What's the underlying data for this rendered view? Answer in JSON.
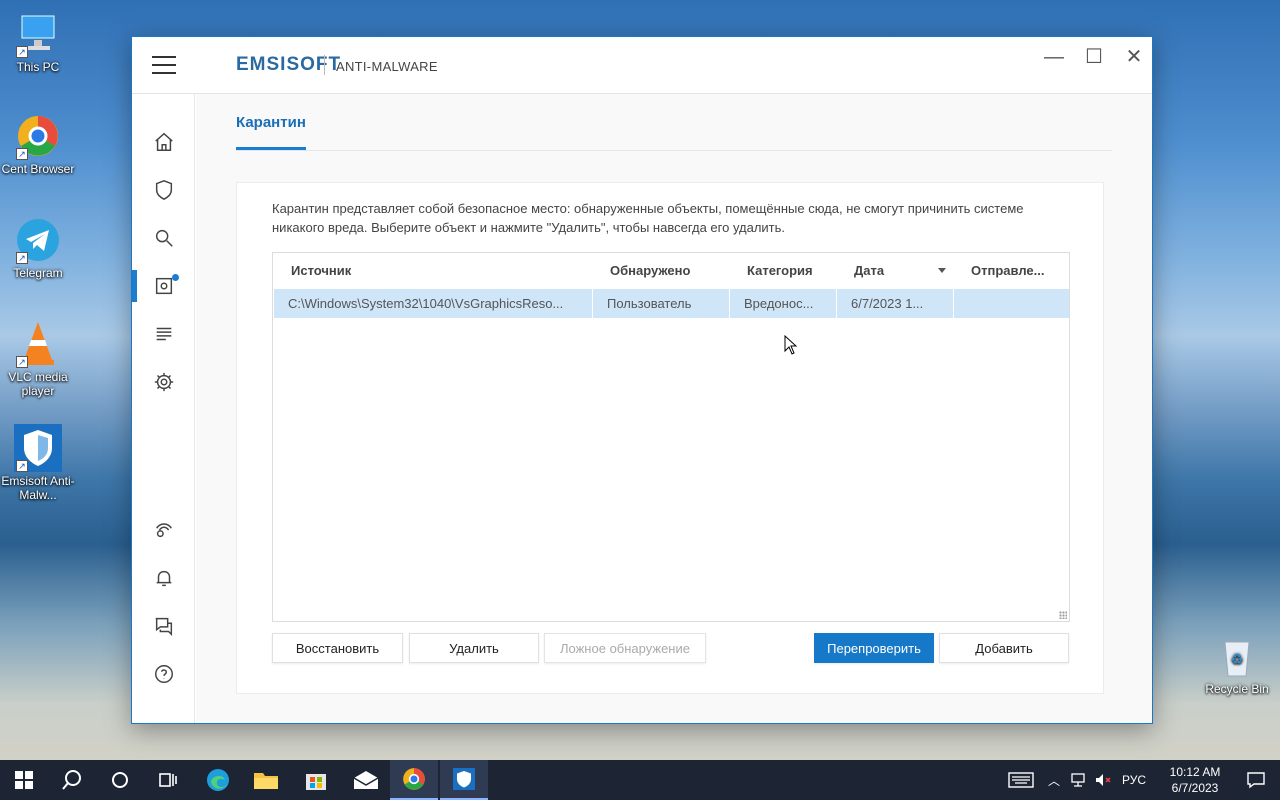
{
  "desktop": {
    "icons": [
      {
        "label": "This PC",
        "icon": "computer-icon"
      },
      {
        "label": "Cent Browser",
        "icon": "cent-browser-icon"
      },
      {
        "label": "Telegram",
        "icon": "telegram-icon"
      },
      {
        "label": "VLC media player",
        "icon": "vlc-icon"
      },
      {
        "label": "Emsisoft Anti-Malw...",
        "icon": "emsisoft-icon"
      },
      {
        "label": "Recycle Bin",
        "icon": "recycle-bin-icon"
      }
    ]
  },
  "window": {
    "brand": "EMSISOFT",
    "product": "ANTI-MALWARE",
    "controls": {
      "minimize": "—",
      "maximize": "☐",
      "close": "✕"
    }
  },
  "sidebar": {
    "items": [
      {
        "name": "home",
        "icon": "home-icon"
      },
      {
        "name": "protection",
        "icon": "shield-icon"
      },
      {
        "name": "scan",
        "icon": "search-icon"
      },
      {
        "name": "quarantine",
        "icon": "quarantine-icon",
        "active": true,
        "badge": true
      },
      {
        "name": "logs",
        "icon": "logs-icon"
      },
      {
        "name": "settings",
        "icon": "gear-icon"
      },
      {
        "name": "remote",
        "icon": "remote-icon"
      },
      {
        "name": "notifications",
        "icon": "bell-icon"
      },
      {
        "name": "support",
        "icon": "chat-icon"
      },
      {
        "name": "help",
        "icon": "help-icon"
      }
    ]
  },
  "main": {
    "tab": "Карантин",
    "description": "Карантин представляет собой безопасное место: обнаруженные объекты, помещённые сюда, не смогут причинить системе никакого вреда. Выберите объект и нажмите \"Удалить\", чтобы навсегда его удалить.",
    "table": {
      "columns": [
        "Источник",
        "Обнаружено",
        "Категория",
        "Дата",
        "Отправле..."
      ],
      "rows": [
        [
          "C:\\Windows\\System32\\1040\\VsGraphicsReso...",
          "Пользователь",
          "Вредонос...",
          "6/7/2023 1...",
          ""
        ]
      ]
    },
    "buttons": {
      "restore": "Восстановить",
      "delete": "Удалить",
      "false_positive": "Ложное обнаружение",
      "rescan": "Перепроверить",
      "add": "Добавить"
    }
  },
  "taskbar": {
    "language": "РУС",
    "time": "10:12 AM",
    "date": "6/7/2023"
  }
}
